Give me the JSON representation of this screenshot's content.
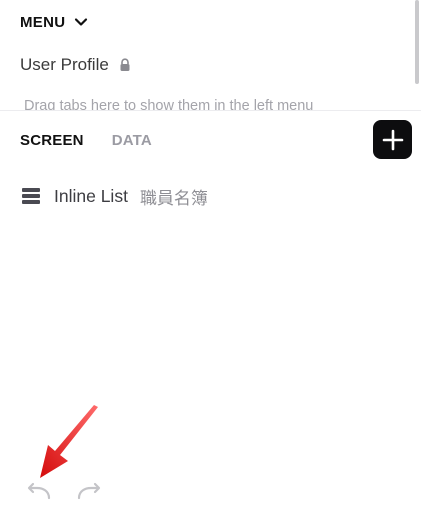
{
  "menu": {
    "title": "MENU",
    "chevron_icon": "chevron-down-icon"
  },
  "profile": {
    "label": "User Profile",
    "lock_icon": "lock-icon"
  },
  "drag_hint": "Drag tabs here to show them in the left menu",
  "tabs": [
    {
      "label": "SCREEN",
      "active": true
    },
    {
      "label": "DATA",
      "active": false
    }
  ],
  "add_button": {
    "icon": "plus-icon"
  },
  "list_item": {
    "icon": "list-icon",
    "name": "Inline List",
    "source": "職員名簿"
  },
  "history": {
    "undo_icon": "undo-icon",
    "redo_icon": "redo-icon"
  },
  "colors": {
    "accent": "#0d0d0f",
    "annotation": "#e8201f",
    "muted_text": "#9b9ba3"
  }
}
